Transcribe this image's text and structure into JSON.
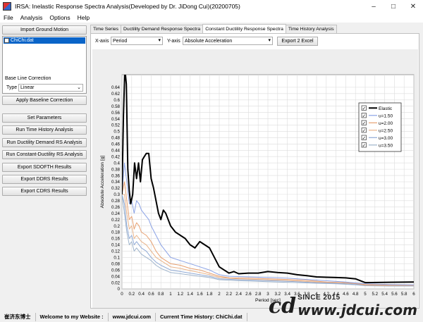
{
  "window": {
    "title": "IRSA: Inelastic Response Spectra Analysis(Developed by Dr. JiDong Cui)(20200705)"
  },
  "menu": [
    "File",
    "Analysis",
    "Options",
    "Help"
  ],
  "left": {
    "import_button": "Import Ground Motion",
    "file_item": "ChiChi.dat",
    "baseline_label": "Base Line Correction",
    "type_label": "Type",
    "type_value": "Linear",
    "apply_button": "Apply Baseline Correction",
    "buttons": [
      "Set Parameters",
      "Run Time History Analysis",
      "Run Ductility Demand RS Analysis",
      "Run Constant-Ductility RS Analysis",
      "Export SDOFTH Results",
      "Export DDRS Results",
      "Export CDRS Results"
    ]
  },
  "tabs": [
    "Time Series",
    "Ductility Demand Response Spectra",
    "Constant Ductility Response Spectra",
    "Time History Analysis"
  ],
  "active_tab": 2,
  "controls": {
    "xaxis_label": "X-axis",
    "xaxis_value": "Period",
    "yaxis_label": "Y-axis",
    "yaxis_value": "Absolute Acceleration",
    "export_button": "Export 2 Excel"
  },
  "status": {
    "author": "崔济东博士",
    "website_label": "Welcome to my Website :",
    "website_url": "www.jdcui.com",
    "current": "Current Time History: ChiChi.dat"
  },
  "watermark": {
    "logo": "cd",
    "since": "SINCE 2015",
    "url": "www.jdcui.com"
  },
  "chart_data": {
    "type": "line",
    "xlabel": "Period [sec]",
    "ylabel": "Absolute Acceleration [g]",
    "xlim": [
      0,
      6
    ],
    "ylim": [
      0,
      0.68
    ],
    "xticks": [
      "0",
      "0.2",
      "0.4",
      "0.6",
      "0.8",
      "1",
      "1.2",
      "1.4",
      "1.6",
      "1.8",
      "2",
      "2.2",
      "2.4",
      "2.6",
      "2.8",
      "3",
      "3.2",
      "3.4",
      "3.6",
      "3.8",
      "4",
      "4.2",
      "4.4",
      "4.6",
      "4.8",
      "5",
      "5.2",
      "5.4",
      "5.6",
      "5.8",
      "6"
    ],
    "yticks": [
      "0",
      "0.02",
      "0.04",
      "0.06",
      "0.08",
      "0.1",
      "0.12",
      "0.14",
      "0.16",
      "0.18",
      "0.2",
      "0.22",
      "0.24",
      "0.26",
      "0.28",
      "0.3",
      "0.32",
      "0.34",
      "0.36",
      "0.38",
      "0.4",
      "0.42",
      "0.44",
      "0.46",
      "0.48",
      "0.5",
      "0.52",
      "0.54",
      "0.56",
      "0.58",
      "0.6",
      "0.62",
      "0.64"
    ],
    "grid": true,
    "legend_position": "top-right",
    "series": [
      {
        "name": "Elastic",
        "color": "#000000",
        "width": 2,
        "x": [
          0,
          0.03,
          0.06,
          0.09,
          0.12,
          0.15,
          0.18,
          0.22,
          0.26,
          0.3,
          0.34,
          0.38,
          0.42,
          0.46,
          0.5,
          0.55,
          0.6,
          0.65,
          0.7,
          0.75,
          0.8,
          0.85,
          0.9,
          1.0,
          1.1,
          1.2,
          1.3,
          1.4,
          1.5,
          1.6,
          1.7,
          1.8,
          1.9,
          2.0,
          2.1,
          2.2,
          2.3,
          2.4,
          2.6,
          2.8,
          3.0,
          3.2,
          3.4,
          3.6,
          3.8,
          4.0,
          4.2,
          4.4,
          4.6,
          4.8,
          5.0,
          5.5,
          6.0
        ],
        "y": [
          0.3,
          0.55,
          0.7,
          0.65,
          0.38,
          0.31,
          0.27,
          0.3,
          0.4,
          0.35,
          0.4,
          0.34,
          0.41,
          0.42,
          0.43,
          0.43,
          0.35,
          0.32,
          0.28,
          0.24,
          0.22,
          0.25,
          0.24,
          0.2,
          0.18,
          0.17,
          0.16,
          0.14,
          0.13,
          0.15,
          0.14,
          0.13,
          0.1,
          0.07,
          0.06,
          0.05,
          0.055,
          0.048,
          0.05,
          0.05,
          0.055,
          0.052,
          0.05,
          0.045,
          0.042,
          0.038,
          0.037,
          0.036,
          0.035,
          0.032,
          0.02,
          0.021,
          0.022
        ]
      },
      {
        "name": "u=1.50",
        "color": "#8aa2e6",
        "width": 1,
        "x": [
          0,
          0.05,
          0.1,
          0.15,
          0.2,
          0.25,
          0.3,
          0.35,
          0.4,
          0.45,
          0.5,
          0.55,
          0.6,
          0.7,
          0.8,
          0.9,
          1.0,
          1.2,
          1.4,
          1.6,
          1.8,
          2.0,
          2.2,
          2.6,
          3.0,
          3.4,
          3.8,
          4.2,
          4.6,
          5.0,
          5.5,
          6.0
        ],
        "y": [
          0.3,
          0.4,
          0.34,
          0.27,
          0.28,
          0.24,
          0.28,
          0.27,
          0.25,
          0.24,
          0.23,
          0.22,
          0.2,
          0.17,
          0.14,
          0.12,
          0.1,
          0.09,
          0.08,
          0.07,
          0.06,
          0.045,
          0.04,
          0.038,
          0.036,
          0.034,
          0.03,
          0.026,
          0.022,
          0.016,
          0.014,
          0.013
        ]
      },
      {
        "name": "u=2.00",
        "color": "#e8a070",
        "width": 1,
        "x": [
          0,
          0.05,
          0.1,
          0.15,
          0.2,
          0.25,
          0.3,
          0.35,
          0.4,
          0.5,
          0.6,
          0.7,
          0.8,
          0.9,
          1.0,
          1.2,
          1.4,
          1.6,
          1.8,
          2.0,
          2.2,
          2.6,
          3.0,
          3.4,
          3.8,
          4.2,
          4.6,
          5.0,
          5.5,
          6.0
        ],
        "y": [
          0.3,
          0.34,
          0.28,
          0.22,
          0.23,
          0.19,
          0.21,
          0.2,
          0.18,
          0.17,
          0.15,
          0.12,
          0.1,
          0.09,
          0.08,
          0.075,
          0.065,
          0.06,
          0.05,
          0.04,
          0.035,
          0.034,
          0.032,
          0.03,
          0.027,
          0.022,
          0.02,
          0.014,
          0.012,
          0.012
        ]
      },
      {
        "name": "u=2.50",
        "color": "#e9b48a",
        "width": 1,
        "x": [
          0,
          0.05,
          0.1,
          0.15,
          0.2,
          0.25,
          0.3,
          0.4,
          0.5,
          0.6,
          0.7,
          0.8,
          1.0,
          1.2,
          1.4,
          1.6,
          1.8,
          2.0,
          2.4,
          2.8,
          3.2,
          3.6,
          4.0,
          4.4,
          4.8,
          5.0,
          5.5,
          6.0
        ],
        "y": [
          0.3,
          0.3,
          0.24,
          0.19,
          0.2,
          0.16,
          0.17,
          0.15,
          0.14,
          0.12,
          0.1,
          0.09,
          0.07,
          0.065,
          0.058,
          0.052,
          0.045,
          0.036,
          0.032,
          0.03,
          0.028,
          0.025,
          0.022,
          0.02,
          0.017,
          0.012,
          0.011,
          0.011
        ]
      },
      {
        "name": "u=3.00",
        "color": "#8faad6",
        "width": 1,
        "x": [
          0,
          0.05,
          0.1,
          0.15,
          0.2,
          0.25,
          0.3,
          0.4,
          0.5,
          0.6,
          0.7,
          0.8,
          1.0,
          1.2,
          1.4,
          1.6,
          1.8,
          2.0,
          2.4,
          2.8,
          3.2,
          3.6,
          4.0,
          4.4,
          4.8,
          5.0,
          5.5,
          6.0
        ],
        "y": [
          0.3,
          0.27,
          0.2,
          0.16,
          0.17,
          0.14,
          0.15,
          0.13,
          0.12,
          0.1,
          0.085,
          0.075,
          0.06,
          0.055,
          0.05,
          0.045,
          0.04,
          0.032,
          0.029,
          0.027,
          0.025,
          0.023,
          0.02,
          0.018,
          0.015,
          0.011,
          0.01,
          0.01
        ]
      },
      {
        "name": "u=3.50",
        "color": "#9fb4cc",
        "width": 1,
        "x": [
          0,
          0.05,
          0.1,
          0.15,
          0.2,
          0.25,
          0.3,
          0.4,
          0.5,
          0.6,
          0.7,
          0.8,
          1.0,
          1.2,
          1.4,
          1.6,
          1.8,
          2.0,
          2.4,
          2.8,
          3.2,
          3.6,
          4.0,
          4.4,
          4.8,
          5.0,
          5.5,
          6.0
        ],
        "y": [
          0.3,
          0.24,
          0.18,
          0.14,
          0.15,
          0.12,
          0.13,
          0.11,
          0.1,
          0.09,
          0.075,
          0.065,
          0.052,
          0.048,
          0.044,
          0.04,
          0.036,
          0.029,
          0.026,
          0.024,
          0.022,
          0.02,
          0.018,
          0.016,
          0.013,
          0.01,
          0.009,
          0.009
        ]
      }
    ]
  }
}
